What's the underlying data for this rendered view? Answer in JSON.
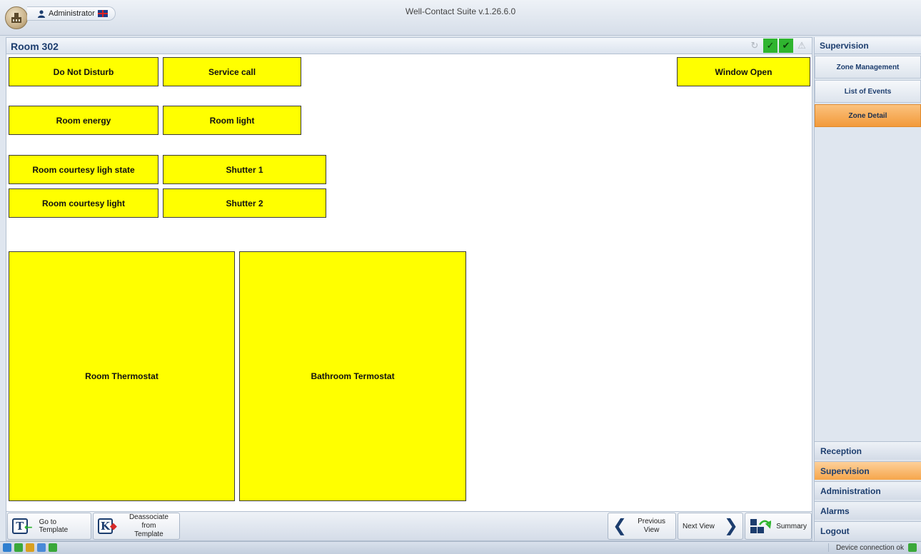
{
  "window": {
    "title": "Well-Contact Suite v.1.26.6.0",
    "user": "Administrator"
  },
  "panel": {
    "title": "Room 302"
  },
  "tiles": {
    "do_not_disturb": "Do Not Disturb",
    "service_call": "Service call",
    "window_open": "Window Open",
    "room_energy": "Room energy",
    "room_light": "Room light",
    "courtesy_state": "Room courtesy ligh state",
    "shutter1": "Shutter 1",
    "courtesy_light": "Room courtesy light",
    "shutter2": "Shutter 2",
    "room_thermostat": "Room Thermostat",
    "bathroom_thermostat": "Bathroom Termostat",
    "tile_color": "#ffff00"
  },
  "toolbar": {
    "go_to_template": "Go to Template",
    "deassociate_line1": "Deassociate from",
    "deassociate_line2": "Template",
    "previous_line1": "Previous",
    "previous_line2": "View",
    "next_view": "Next View",
    "summary": "Summary"
  },
  "sidebar": {
    "header": "Supervision",
    "items": [
      "Zone Management",
      "List of Events",
      "Zone Detail"
    ],
    "active_item": "Zone Detail",
    "sections": [
      "Reception",
      "Supervision",
      "Administration",
      "Alarms",
      "Logout"
    ],
    "active_section": "Supervision",
    "accent_color": "#f29a3a"
  },
  "statusbar": {
    "connection": "Device connection ok"
  }
}
